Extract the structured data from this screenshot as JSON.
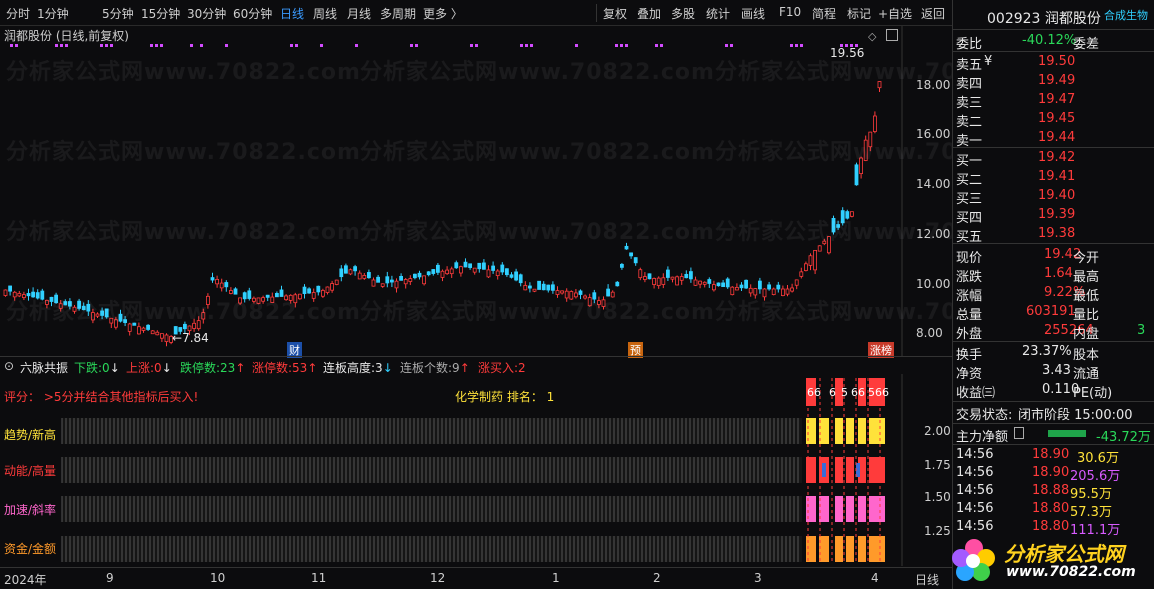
{
  "toolbar": {
    "tabs": [
      "分时",
      "1分钟",
      "5分钟",
      "15分钟",
      "30分钟",
      "60分钟",
      "日线",
      "周线",
      "月线",
      "多周期",
      "更多 〉"
    ],
    "active_tab": "日线",
    "right_buttons": [
      "复权",
      "叠加",
      "多股",
      "统计",
      "画线",
      "F10",
      "简程",
      "标记",
      "+自选",
      "返回"
    ]
  },
  "chart": {
    "title": "润都股份 (日线,前复权)",
    "high_label": "19.56",
    "low_label": "7.84",
    "y_ticks": [
      "18.00",
      "16.00",
      "14.00",
      "12.00",
      "10.00",
      "8.00"
    ],
    "markers": [
      "财",
      "预",
      "涨榜"
    ],
    "watermark": "分析家公式网www.70822.com"
  },
  "indicator_bar": {
    "name": "六脉共振",
    "items": [
      {
        "label": "下跌:",
        "value": "0",
        "arrow": "↓",
        "color": "#2ad95a"
      },
      {
        "label": "上涨:",
        "value": "0",
        "arrow": "↓",
        "color": "#ff3b3b"
      },
      {
        "label": "跌停数:",
        "value": "23",
        "arrow": "↑",
        "color": "#2ad95a"
      },
      {
        "label": "涨停数:",
        "value": "53",
        "arrow": "↑",
        "color": "#ff3b3b"
      },
      {
        "label": "连板高度:",
        "value": "3",
        "arrow": "↓",
        "color": "#e8e8e8"
      },
      {
        "label": "连板个数:",
        "value": "9",
        "arrow": "↑",
        "color": "#aaaaaa"
      },
      {
        "label": "涨买入:",
        "value": "2",
        "arrow": "",
        "color": "#ff3b3b"
      }
    ]
  },
  "lower": {
    "score_text": "评分：  >5分并结合其他指标后买入!",
    "sector_text": "化学制药  排名：  1",
    "rows": [
      "趋势/新高",
      "动能/高量",
      "加速/斜率",
      "资金/金额"
    ],
    "row_colors": [
      "#ffe23a",
      "#ff3b3b",
      "#ff66cc",
      "#ff9a2a"
    ],
    "y_ticks": [
      "2.00",
      "1.75",
      "1.50",
      "1.25"
    ],
    "top_nums": [
      "66",
      "6",
      "5",
      "66",
      "566"
    ]
  },
  "time_axis": {
    "labels": [
      "2024年",
      "9",
      "10",
      "11",
      "12",
      "1",
      "2",
      "3",
      "4"
    ],
    "period": "日线"
  },
  "right_panel": {
    "code": "002923",
    "name": "润都股份",
    "tag": "合成生物",
    "webi_label": "委比",
    "webi_value": "-40.12%",
    "weicha_label": "委差",
    "asks": [
      {
        "label": "卖五",
        "mark": "¥",
        "price": "19.50"
      },
      {
        "label": "卖四",
        "mark": "",
        "price": "19.49"
      },
      {
        "label": "卖三",
        "mark": "",
        "price": "19.47"
      },
      {
        "label": "卖二",
        "mark": "",
        "price": "19.45"
      },
      {
        "label": "卖一",
        "mark": "",
        "price": "19.44"
      }
    ],
    "bids": [
      {
        "label": "买一",
        "price": "19.42"
      },
      {
        "label": "买二",
        "price": "19.41"
      },
      {
        "label": "买三",
        "price": "19.40"
      },
      {
        "label": "买四",
        "price": "19.39"
      },
      {
        "label": "买五",
        "price": "19.38"
      }
    ],
    "quote": [
      {
        "label": "现价",
        "value": "19.42",
        "label2": "今开"
      },
      {
        "label": "涨跌",
        "value": "1.64",
        "label2": "最高"
      },
      {
        "label": "涨幅",
        "value": "9.22%",
        "label2": "最低"
      },
      {
        "label": "总量",
        "value": "603191",
        "label2": "量比"
      },
      {
        "label": "外盘",
        "value": "255264",
        "label2": "内盘",
        "value2": "3"
      }
    ],
    "stats": [
      {
        "label": "换手",
        "value": "23.37%",
        "label2": "股本"
      },
      {
        "label": "净资",
        "value": "3.43",
        "label2": "流通"
      },
      {
        "label": "收益㈢",
        "value": "0.110",
        "label2": "PE(动)"
      }
    ],
    "status_label": "交易状态:",
    "status_value": "闭市阶段 15:00:00",
    "flow_label": "主力净额",
    "flow_value": "-43.72万",
    "ticks": [
      {
        "time": "14:56",
        "price": "18.90",
        "vol": "30.6万"
      },
      {
        "time": "14:56",
        "price": "18.90",
        "vol": "205.6万"
      },
      {
        "time": "14:56",
        "price": "18.88",
        "vol": "95.5万"
      },
      {
        "time": "14:56",
        "price": "18.80",
        "vol": "57.3万"
      },
      {
        "time": "14:56",
        "price": "18.80",
        "vol": "111.1万"
      }
    ],
    "logo_text": "分析家公式网",
    "logo_url": "www.70822.com"
  }
}
